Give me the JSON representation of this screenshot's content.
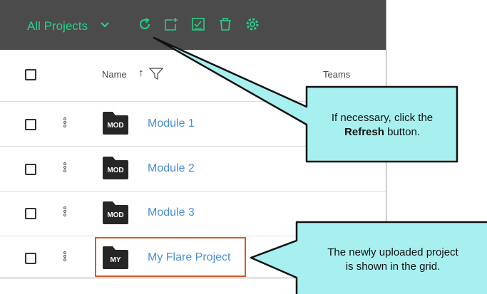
{
  "toolbar": {
    "title": "All Projects",
    "icons": [
      "refresh-icon",
      "add-project-icon",
      "select-all-icon",
      "delete-icon",
      "settings-icon"
    ],
    "accent_color": "#27d18b",
    "background_color": "#4b4b4b"
  },
  "grid": {
    "columns": {
      "name": "Name",
      "teams": "Teams"
    },
    "rows": [
      {
        "label": "MOD",
        "name": "Module 1"
      },
      {
        "label": "MOD",
        "name": "Module 2"
      },
      {
        "label": "MOD",
        "name": "Module 3"
      },
      {
        "label": "MY",
        "name": "My Flare Project"
      }
    ]
  },
  "callouts": {
    "refresh": {
      "line1": "If necessary, click the",
      "bold": "Refresh",
      "rest": "button."
    },
    "grid": {
      "line1": "The newly uploaded project",
      "line2": "is shown in the grid."
    },
    "fill_color": "#a8f0f0"
  },
  "highlight_color": "#d6582a"
}
